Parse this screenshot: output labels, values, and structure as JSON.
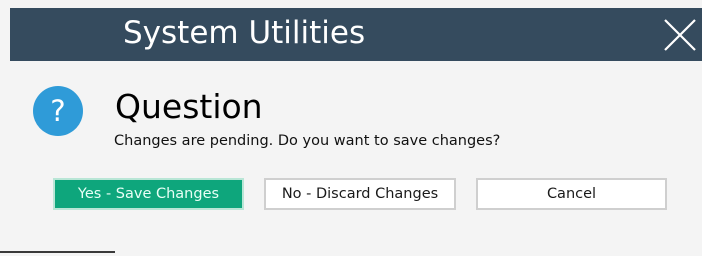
{
  "window": {
    "title": "System Utilities",
    "close_icon": "close-icon"
  },
  "dialog": {
    "icon": "question-icon",
    "icon_color": "#2f9bd8",
    "heading": "Question",
    "message": "Changes are pending. Do you want to save changes?"
  },
  "buttons": {
    "yes_label": "Yes - Save Changes",
    "no_label": "No - Discard Changes",
    "cancel_label": "Cancel"
  },
  "colors": {
    "title_bar": "#354b5e",
    "primary_button": "#0ea67c"
  }
}
